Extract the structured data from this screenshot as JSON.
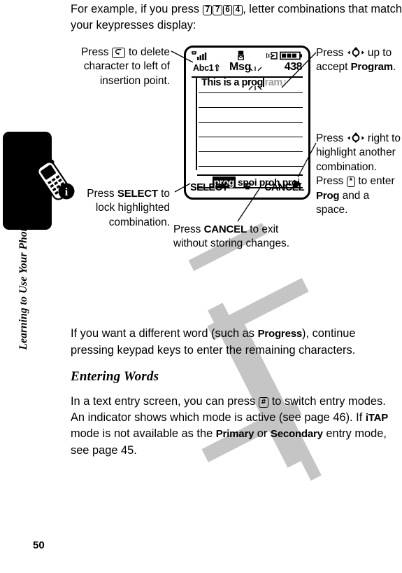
{
  "sidebar": {
    "chapter_title": "Learning to Use Your Phone",
    "tab_icon": "phone-handset-icon",
    "badge_icon": "info-badge-icon"
  },
  "page_number": "50",
  "paragraphs": {
    "intro_pre": "For example, if you press ",
    "intro_keys": [
      "7",
      "7",
      "6",
      "4"
    ],
    "intro_post": ", letter combinations that match your keypresses display:",
    "different_word_pre": "If you want a different word (such as ",
    "different_word_bold": "Progress",
    "different_word_post": "), continue pressing keypad keys to enter the remaining characters.",
    "subhead": "Entering Words",
    "entry_1": "In a text entry screen, you can press ",
    "entry_key": "#",
    "entry_2": " to switch entry modes. An indicator shows which mode is active (see page 46). If ",
    "entry_bold_1": "iTAP",
    "entry_3": " mode is not available as the ",
    "entry_bold_2": "Primary",
    "entry_4": " or ",
    "entry_bold_3": "Secondary",
    "entry_5": " entry mode, see page 45."
  },
  "callouts": {
    "delete": {
      "pre": "Press ",
      "key": "C",
      "post": " to delete character to left of insertion point."
    },
    "select": {
      "pre": "Press ",
      "bold": "SELECT",
      "post": " to lock highlighted combination."
    },
    "cancel": {
      "pre": "Press ",
      "bold": "CANCEL",
      "post": " to exit without storing changes."
    },
    "accept": {
      "pre": "Press ",
      "nav": "nav-key-icon",
      "mid": " up to accept ",
      "bold": "Program",
      "post": "."
    },
    "right": {
      "pre": "Press ",
      "nav": "nav-key-icon",
      "mid": " right to highlight another combination. Press ",
      "key": "*",
      "mid2": " to enter ",
      "bold": "Prog",
      "post": " and a space."
    }
  },
  "phone_screen": {
    "status": {
      "signal_icon": "signal-bars-icon",
      "envelope_icon": "message-envelope-icon",
      "ringer_icon": "ringer-alert-icon",
      "battery_icon": "battery-full-icon"
    },
    "mode_indicator": "Abc1",
    "shift_glyph": "⇧",
    "title": "Msg",
    "char_count": "438",
    "text_entered": "This is a prog",
    "text_suggestion": "ram",
    "suggestion_arrow": "↑",
    "candidates": [
      "prog",
      "spoi",
      "proh",
      "proi"
    ],
    "selected_candidate_index": 0,
    "more_arrow": "▶",
    "softkey_left": "SELECT",
    "softkey_center": "menu-icon",
    "softkey_right": "CANCEL",
    "blank_line_count": 5
  },
  "colors": {
    "ink": "#000000",
    "paper": "#ffffff",
    "suggestion_grey": "#9a9a9a",
    "watermark_grey": "#c2c2c2"
  }
}
